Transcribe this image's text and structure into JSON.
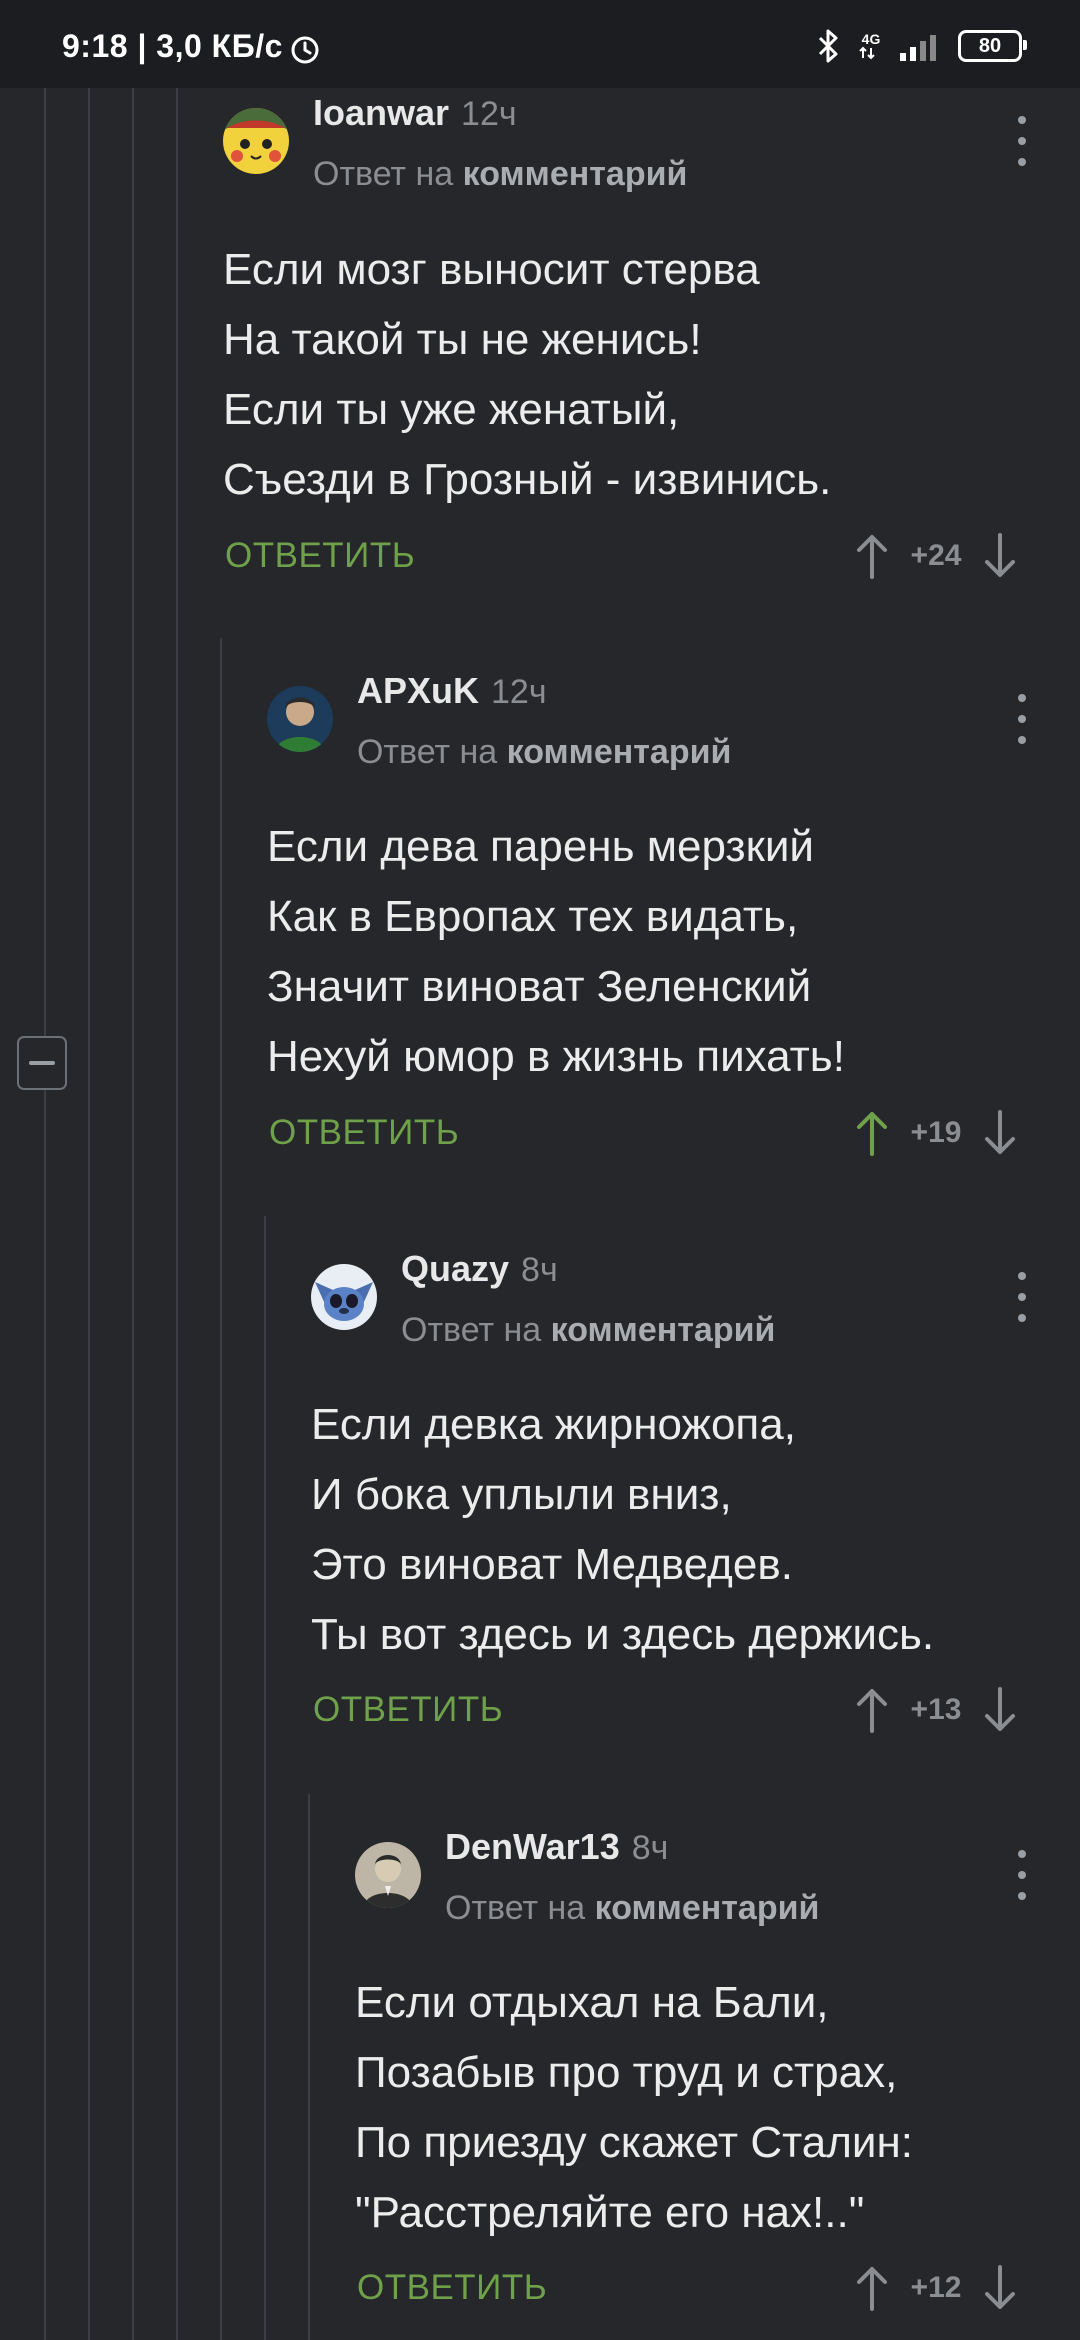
{
  "status_bar": {
    "time_speed": "9:18 | 3,0 КБ/с",
    "network": "4G",
    "battery": "80"
  },
  "labels": {
    "reply_prefix": "Ответ на",
    "reply_target": "комментарий",
    "answer_button": "ОТВЕТИТЬ"
  },
  "comments": [
    {
      "author": "Ioanwar",
      "time": "12ч",
      "lines": [
        "Если мозг выносит стерва",
        "На такой ты не женись!",
        "Если ты уже женатый,",
        "Съезди в Грозный - извинись."
      ],
      "score": "+24"
    },
    {
      "author": "APXuK",
      "time": "12ч",
      "lines": [
        "Если дева парень мерзкий",
        "Как в Европах тех видать,",
        "Значит виноват Зеленский",
        "Нехуй юмор в жизнь пихать!"
      ],
      "score": "+19"
    },
    {
      "author": "Quazy",
      "time": "8ч",
      "lines": [
        "Если девка жирножопа,",
        "И бока уплыли вниз,",
        "Это виноват Медведев.",
        "Ты вот здесь и здесь держись."
      ],
      "score": "+13"
    },
    {
      "author": "DenWar13",
      "time": "8ч",
      "lines": [
        "Если отдыхал на Бали,",
        "Позабыв про труд и страх,",
        "По приезду скажет Сталин:",
        "\"Расстреляйте его нах!..\""
      ],
      "score": "+12"
    }
  ],
  "colors": {
    "background": "#25272b",
    "accent_green": "#6fa04a",
    "muted": "#8a8d92"
  }
}
